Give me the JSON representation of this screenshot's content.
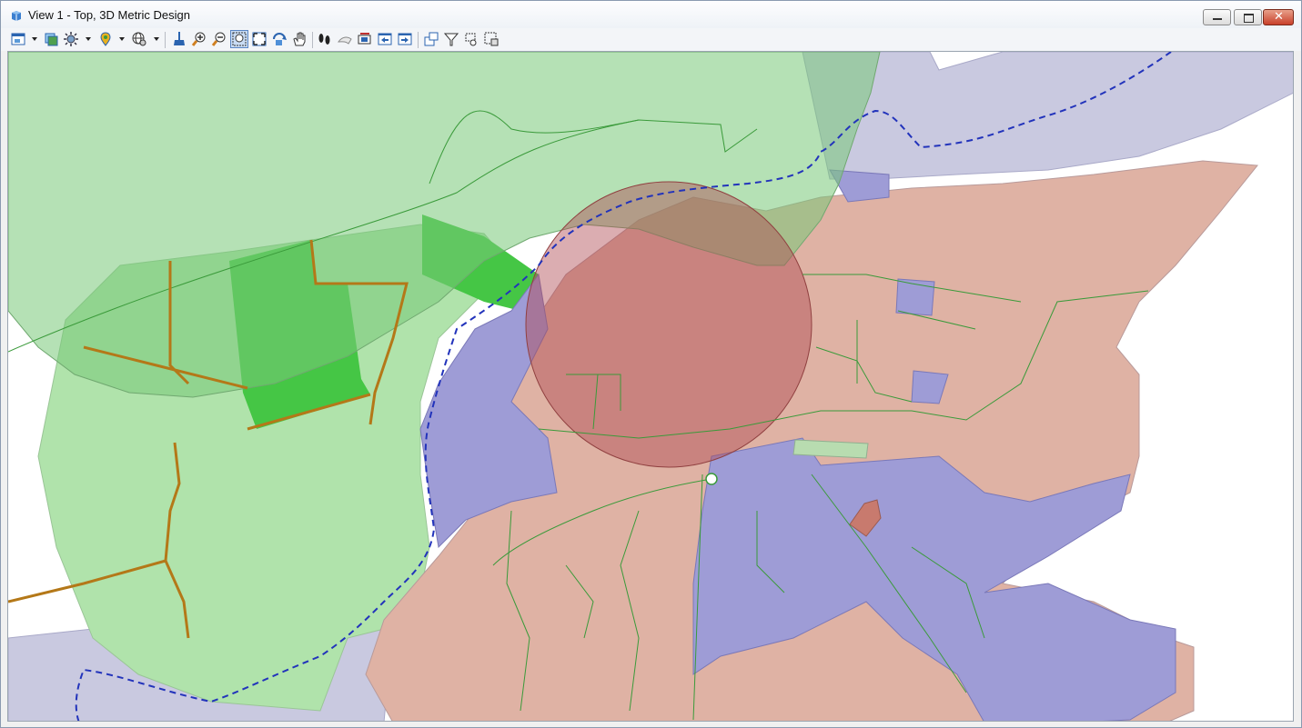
{
  "window": {
    "title": "View 1 - Top, 3D Metric Design"
  },
  "window_controls": {
    "minimize": "minimize-icon",
    "maximize": "maximize-icon",
    "close_glyph": "✕"
  },
  "toolbar": {
    "icons": [
      "view-attributes-icon",
      "levels-icon",
      "lighting-icon",
      "place-marker-icon",
      "global-lighting-icon",
      "update-view-icon",
      "zoom-in-icon",
      "zoom-out-icon",
      "window-area-icon",
      "fit-view-icon",
      "rotate-view-icon",
      "pan-view-icon",
      "walk-icon",
      "clip-volume-icon",
      "camera-icon",
      "previous-view-icon",
      "next-view-icon",
      "view-copy-icon",
      "clip-mask-icon",
      "fence-icon",
      "select-area-icon"
    ]
  },
  "colors": {
    "salmon_zone": "#d9a89a",
    "purple_zone": "#9c9ad8",
    "light_green_zone": "#9fd99b",
    "bright_green_zone": "#3fc43f",
    "red_buffer": "#b04a52",
    "grey_band": "#b6b7d6",
    "boundary_dashed": "#2a3fbf",
    "road_line": "#2e9a2e",
    "track_brown": "#b0760e"
  }
}
